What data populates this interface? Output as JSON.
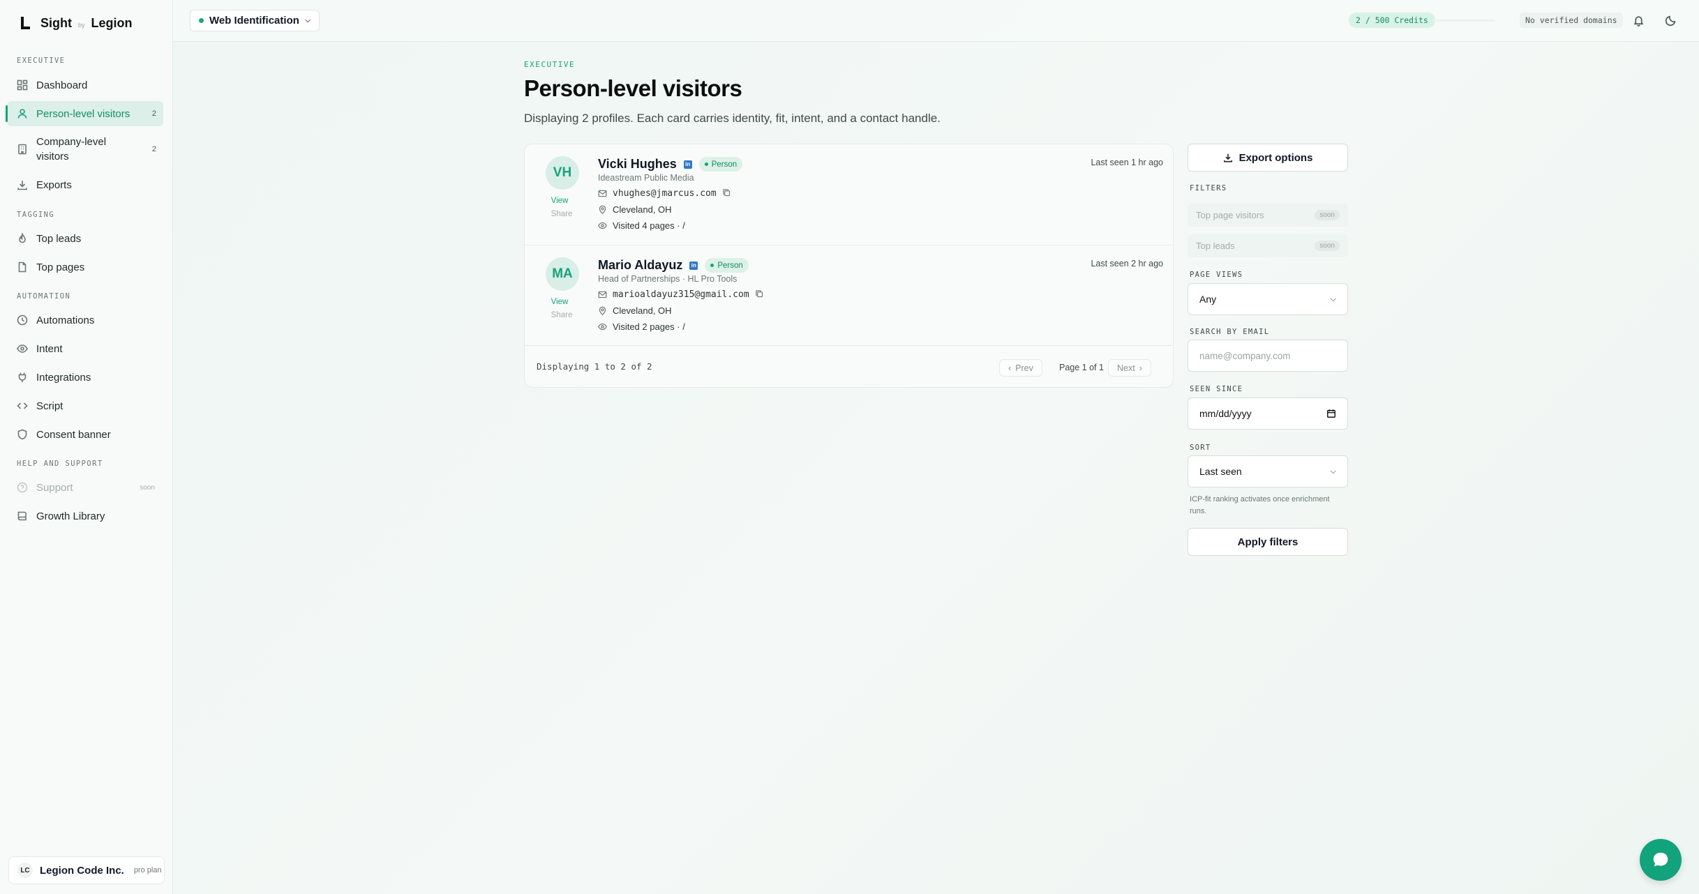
{
  "brand": {
    "name": "Sight",
    "by": "by",
    "org_name": "Legion"
  },
  "sidebar": {
    "sections": {
      "executive": "EXECUTIVE",
      "tagging": "TAGGING",
      "automation": "AUTOMATION",
      "help": "HELP AND SUPPORT"
    },
    "items": {
      "dashboard": {
        "label": "Dashboard"
      },
      "person_visitors": {
        "label": "Person-level visitors",
        "count": "2"
      },
      "company_visitors": {
        "label": "Company-level visitors",
        "count": "2"
      },
      "exports": {
        "label": "Exports"
      },
      "top_leads": {
        "label": "Top leads"
      },
      "top_pages": {
        "label": "Top pages"
      },
      "automations": {
        "label": "Automations"
      },
      "intent": {
        "label": "Intent"
      },
      "integrations": {
        "label": "Integrations"
      },
      "script": {
        "label": "Script"
      },
      "consent_banner": {
        "label": "Consent banner"
      },
      "support": {
        "label": "Support",
        "badge": "soon"
      },
      "growth_library": {
        "label": "Growth Library"
      }
    },
    "org": {
      "initials": "LC",
      "name": "Legion Code Inc.",
      "plan": "pro plan"
    }
  },
  "topbar": {
    "workspace": "Web Identification",
    "credits": "2 / 500 Credits",
    "domains": "No verified domains"
  },
  "main": {
    "eyebrow": "EXECUTIVE",
    "title": "Person-level visitors",
    "subtitle": "Displaying 2 profiles. Each card carries identity, fit, intent, and a contact handle.",
    "people": [
      {
        "initials": "VH",
        "name": "Vicki Hughes",
        "badge": "Person",
        "company": "Ideastream Public Media",
        "email": "vhughes@jmarcus.com",
        "location": "Cleveland, OH",
        "visited": "Visited 4 pages · /",
        "last_seen": "Last seen 1 hr ago",
        "view": "View",
        "share": "Share"
      },
      {
        "initials": "MA",
        "name": "Mario Aldayuz",
        "badge": "Person",
        "company": "Head of Partnerships · HL Pro Tools",
        "email": "marioaldayuz315@gmail.com",
        "location": "Cleveland, OH",
        "visited": "Visited 2 pages · /",
        "last_seen": "Last seen 2 hr ago",
        "view": "View",
        "share": "Share"
      }
    ],
    "footer": {
      "showing": "Displaying 1 to 2 of 2",
      "prev": "Prev",
      "page_info": "Page 1 of 1",
      "next": "Next"
    }
  },
  "filters": {
    "export_label": "Export options",
    "filters_label": "FILTERS",
    "top_page_visitors": "Top page visitors",
    "top_leads": "Top leads",
    "soon": "soon",
    "page_views_label": "PAGE VIEWS",
    "page_views_value": "Any",
    "search_email_label": "SEARCH BY EMAIL",
    "search_email_placeholder": "name@company.com",
    "seen_since_label": "SEEN SINCE",
    "seen_since_placeholder": "mm/dd/yyyy",
    "sort_label": "SORT",
    "sort_value": "Last seen",
    "note": "ICP-fit ranking activates once enrichment runs.",
    "apply_label": "Apply filters"
  },
  "colors": {
    "accent": "#16a37a",
    "linkedin": "#2f78c7"
  }
}
